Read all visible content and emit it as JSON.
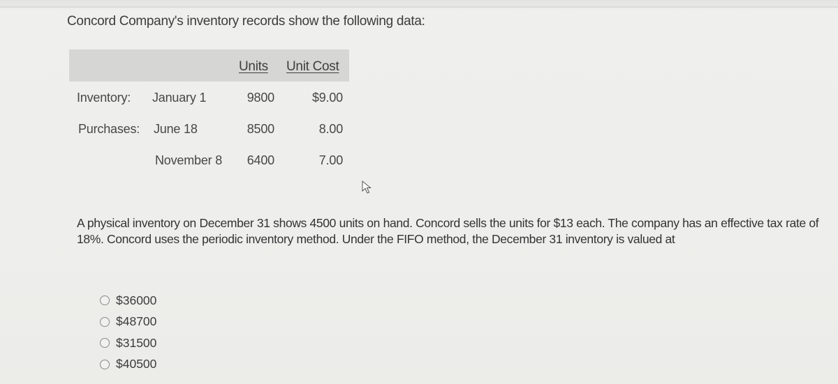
{
  "intro_text": "Concord Company's inventory records show the following data:",
  "table": {
    "columns": [
      "",
      "",
      "Units",
      "Unit Cost"
    ],
    "rows": [
      {
        "label": "Inventory:",
        "date": "January 1",
        "units": "9800",
        "unit_cost": "$9.00"
      },
      {
        "label": "Purchases:",
        "date": "June 18",
        "units": "8500",
        "unit_cost": "8.00"
      },
      {
        "label": "",
        "date": "November 8",
        "units": "6400",
        "unit_cost": "7.00"
      }
    ]
  },
  "question_text": "A physical inventory on December 31 shows 4500 units on hand. Concord sells the units for $13 each. The company has an effective tax rate of 18%. Concord uses the periodic inventory method. Under the FIFO method, the December 31 inventory is valued at",
  "answer_options": [
    {
      "label": "$36000",
      "selected": false
    },
    {
      "label": "$48700",
      "selected": false
    },
    {
      "label": "$31500",
      "selected": false
    },
    {
      "label": "$40500",
      "selected": false
    }
  ],
  "cursor_icon": "mouse-pointer-icon"
}
